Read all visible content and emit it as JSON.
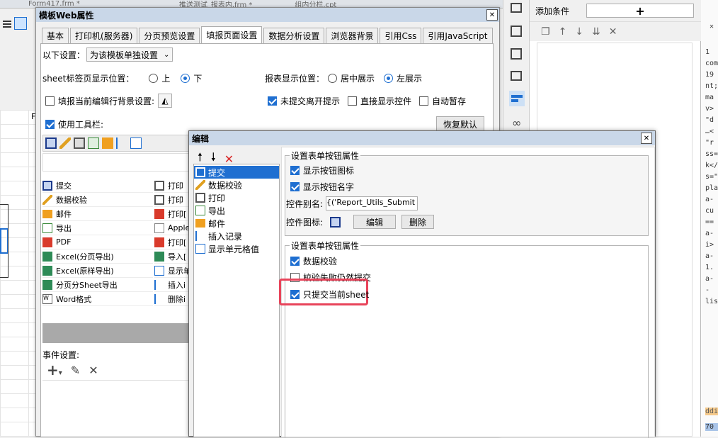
{
  "bg": {
    "tabs": [
      "Form417.frm *",
      "推送测试_报表内.frm *",
      "组内分栏.cpt"
    ],
    "col_f": "F"
  },
  "right": {
    "add_condition": "添加条件",
    "add_plus": "+",
    "strip": [
      "1",
      "com",
      "19",
      "nt;",
      "ma",
      "v>",
      "\"d",
      "…<",
      "\"r",
      "ss=",
      "k</",
      "s=\"",
      "pla",
      "a-",
      "cu",
      "==",
      "a-",
      "i>",
      "a-",
      "1.",
      "a-",
      "-lis"
    ],
    "bottom_strip": [
      "ddir",
      "70"
    ]
  },
  "main": {
    "title": "模板Web属性",
    "close": "✕",
    "tabs": [
      "基本",
      "打印机(服务器)",
      "分页预览设置",
      "填报页面设置",
      "数据分析设置",
      "浏览器背景",
      "引用Css",
      "引用JavaScript"
    ],
    "active_tab": 3,
    "settings_label": "以下设置：",
    "settings_value": "为该模板单独设置",
    "sheet_pos_label": "sheet标签页显示位置：",
    "pos_top": "上",
    "pos_bottom": "下",
    "report_pos_label": "报表显示位置：",
    "center_show": "居中展示",
    "left_show": "左展示",
    "bg_label": "填报当前编辑行背景设置:",
    "unsubmitted_label": "未提交离开提示",
    "direct_control": "直接显示控件",
    "auto_save": "自动暂存",
    "use_toolbar": "使用工具栏:",
    "restore_default": "恢复默认",
    "buttons_left": [
      "提交",
      "数据校验",
      "邮件",
      "导出",
      "PDF",
      "Excel(分页导出)",
      "Excel(原样导出)",
      "分页分Sheet导出",
      "Word格式"
    ],
    "buttons_right": [
      "打印",
      "打印",
      "打印[",
      "Apple",
      "打印[",
      "导入[",
      "显示单",
      "插入i",
      "删除i"
    ],
    "event_label": "事件设置:"
  },
  "edit": {
    "title": "编辑",
    "close": "✕",
    "list": [
      "提交",
      "数据校验",
      "打印",
      "导出",
      "邮件",
      "插入记录",
      "显示单元格值"
    ],
    "form_group": "设置表单按钮属性",
    "show_icon": "显示按钮图标",
    "show_name": "显示按钮名字",
    "alias_label": "控件别名:",
    "alias_value": "Report_Utils_Submit')}",
    "icon_label": "控件图标:",
    "edit_btn": "编辑",
    "delete_btn": "删除",
    "form_group2": "设置表单按钮属性",
    "data_check": "数据校验",
    "fail_submit": "校验失败仍然提交",
    "only_current": "只提交当前sheet"
  }
}
